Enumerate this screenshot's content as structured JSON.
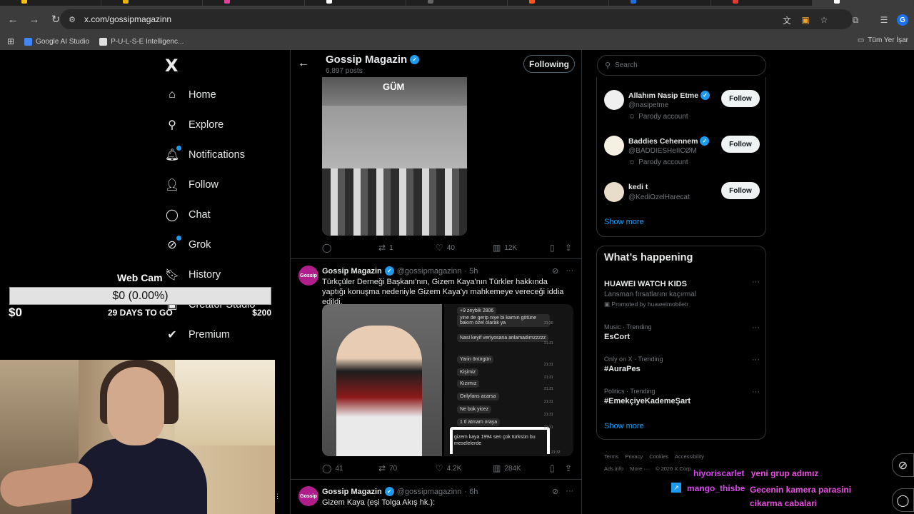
{
  "browser": {
    "url": "x.com/gossipmagazinn",
    "tab_colors": [
      "#f4c20d",
      "#e8b300",
      "#e040a0",
      "#ffffff",
      "#666666",
      "#ff5722",
      "#1d6fe0",
      "#e53935",
      "#ffffff"
    ],
    "bookmarks": [
      {
        "label": "Google AI Studio",
        "color": "#4285f4"
      },
      {
        "label": "P-U-L-S-E Intelligenc...",
        "color": "#e0e0e0"
      }
    ],
    "bookmarks_right": "Tüm Yer İşar",
    "profile_initial": "G"
  },
  "nav": {
    "logo": "X",
    "items": [
      {
        "label": "Home",
        "icon": "home-icon"
      },
      {
        "label": "Explore",
        "icon": "search-icon"
      },
      {
        "label": "Notifications",
        "icon": "bell-icon",
        "badge": "6"
      },
      {
        "label": "Follow",
        "icon": "follow-icon"
      },
      {
        "label": "Chat",
        "icon": "chat-icon"
      },
      {
        "label": "Grok",
        "icon": "grok-icon"
      },
      {
        "label": "History",
        "icon": "bookmark-icon"
      },
      {
        "label": "Creator Studio",
        "icon": "creator-studio-icon"
      },
      {
        "label": "Premium",
        "icon": "premium-icon"
      }
    ]
  },
  "goal_widget": {
    "title": "Web Cam",
    "amount": "$0 (0.00%)",
    "progress": 0.0,
    "min": "$0",
    "days": "29 DAYS TO GO",
    "max": "$200"
  },
  "profile": {
    "name": "Gossip Magazin",
    "posts": "6,897 posts",
    "following_label": "Following"
  },
  "tweets": [
    {
      "media_caption": "GÜM",
      "replies": "",
      "reposts": "1",
      "likes": "40",
      "views": "12K"
    },
    {
      "avatar_text": "Gossip",
      "name": "Gossip Magazin",
      "handle": "@gossipmagazinn",
      "time": "· 5h",
      "text": "Türkçüler Derneği Başkanı'nın, Gizem Kaya'nın Türkler hakkında yaptığı konuşma nedeniyle Gizem Kaya'yı mahkemeye vereceği iddia edildi.",
      "chat": [
        {
          "text": "+9 zeybik 2806",
          "time": ""
        },
        {
          "text": "yine de gerip niye bi karnın götüne bakım özel olarak ya",
          "time": "21:30"
        },
        {
          "text": "Nasi keyif veriyosana anlamadımzzzzz",
          "time": "21:31"
        },
        {
          "text": "Yarin önürgün",
          "time": "21:31"
        },
        {
          "text": "Kişimiz",
          "time": "21:31"
        },
        {
          "text": "Kızımız",
          "time": "21:31"
        },
        {
          "text": "Onlyfans acarsa",
          "time": "21:31"
        },
        {
          "text": "Ne bok yicez",
          "time": "21:31"
        },
        {
          "text": "1 tl atmam oraya",
          "time": "21:31"
        }
      ],
      "chat_signature": "gizem kaya 1994 sen çok türksün bu meselelerde",
      "chat_signature_time": "21:32",
      "replies": "41",
      "reposts": "70",
      "likes": "4.2K",
      "views": "284K"
    },
    {
      "avatar_text": "Gossip",
      "name": "Gossip Magazin",
      "handle": "@gossipmagazinn",
      "time": "· 6h",
      "text": "Gizem Kaya (eşi Tolga Akış hk.):"
    }
  ],
  "search": {
    "placeholder": "Search"
  },
  "who_to_follow": {
    "users": [
      {
        "name": "Allahım Nasip Etme",
        "handle": "@nasipetme",
        "note": "Parody account",
        "avatar_color": "#f0f0f0"
      },
      {
        "name": "Baddies Cehennem",
        "handle": "@BADDIESHeIICØM",
        "note": "Parody account",
        "avatar_color": "#f5f0e1"
      },
      {
        "name": "kedi t",
        "handle": "@KediOzelHarecat",
        "note": "",
        "avatar_color": "#e8dccb"
      }
    ],
    "follow_label": "Follow",
    "show_more": "Show more"
  },
  "trends": {
    "title": "What’s happening",
    "items": [
      {
        "context": "",
        "title": "HUAWEI WATCH KIDS",
        "subtitle": "Lansman fırsatlarını kaçırmal",
        "promo": "Promoted by huaweimobiletr"
      },
      {
        "context": "Music · Trending",
        "title": "EsCort",
        "subtitle": "",
        "promo": ""
      },
      {
        "context": "Only on X · Trending",
        "title": "#AuraPes",
        "subtitle": "",
        "promo": ""
      },
      {
        "context": "Politics · Trending",
        "title": "#EmekçiyeKademeŞart",
        "subtitle": "",
        "promo": ""
      }
    ],
    "show_more": "Show more"
  },
  "footer": {
    "links": [
      "Terms",
      "Privacy",
      "Cookies",
      "Accessibility",
      "Ads info",
      "More ···",
      "© 2026 X Corp."
    ]
  },
  "stream_chat": [
    {
      "user": "hiyoriscarlet",
      "message": "yeni grup adımız"
    },
    {
      "user": "mango_thisbe",
      "message": "Gecenin kamera parasini cikarma cabalari"
    }
  ]
}
